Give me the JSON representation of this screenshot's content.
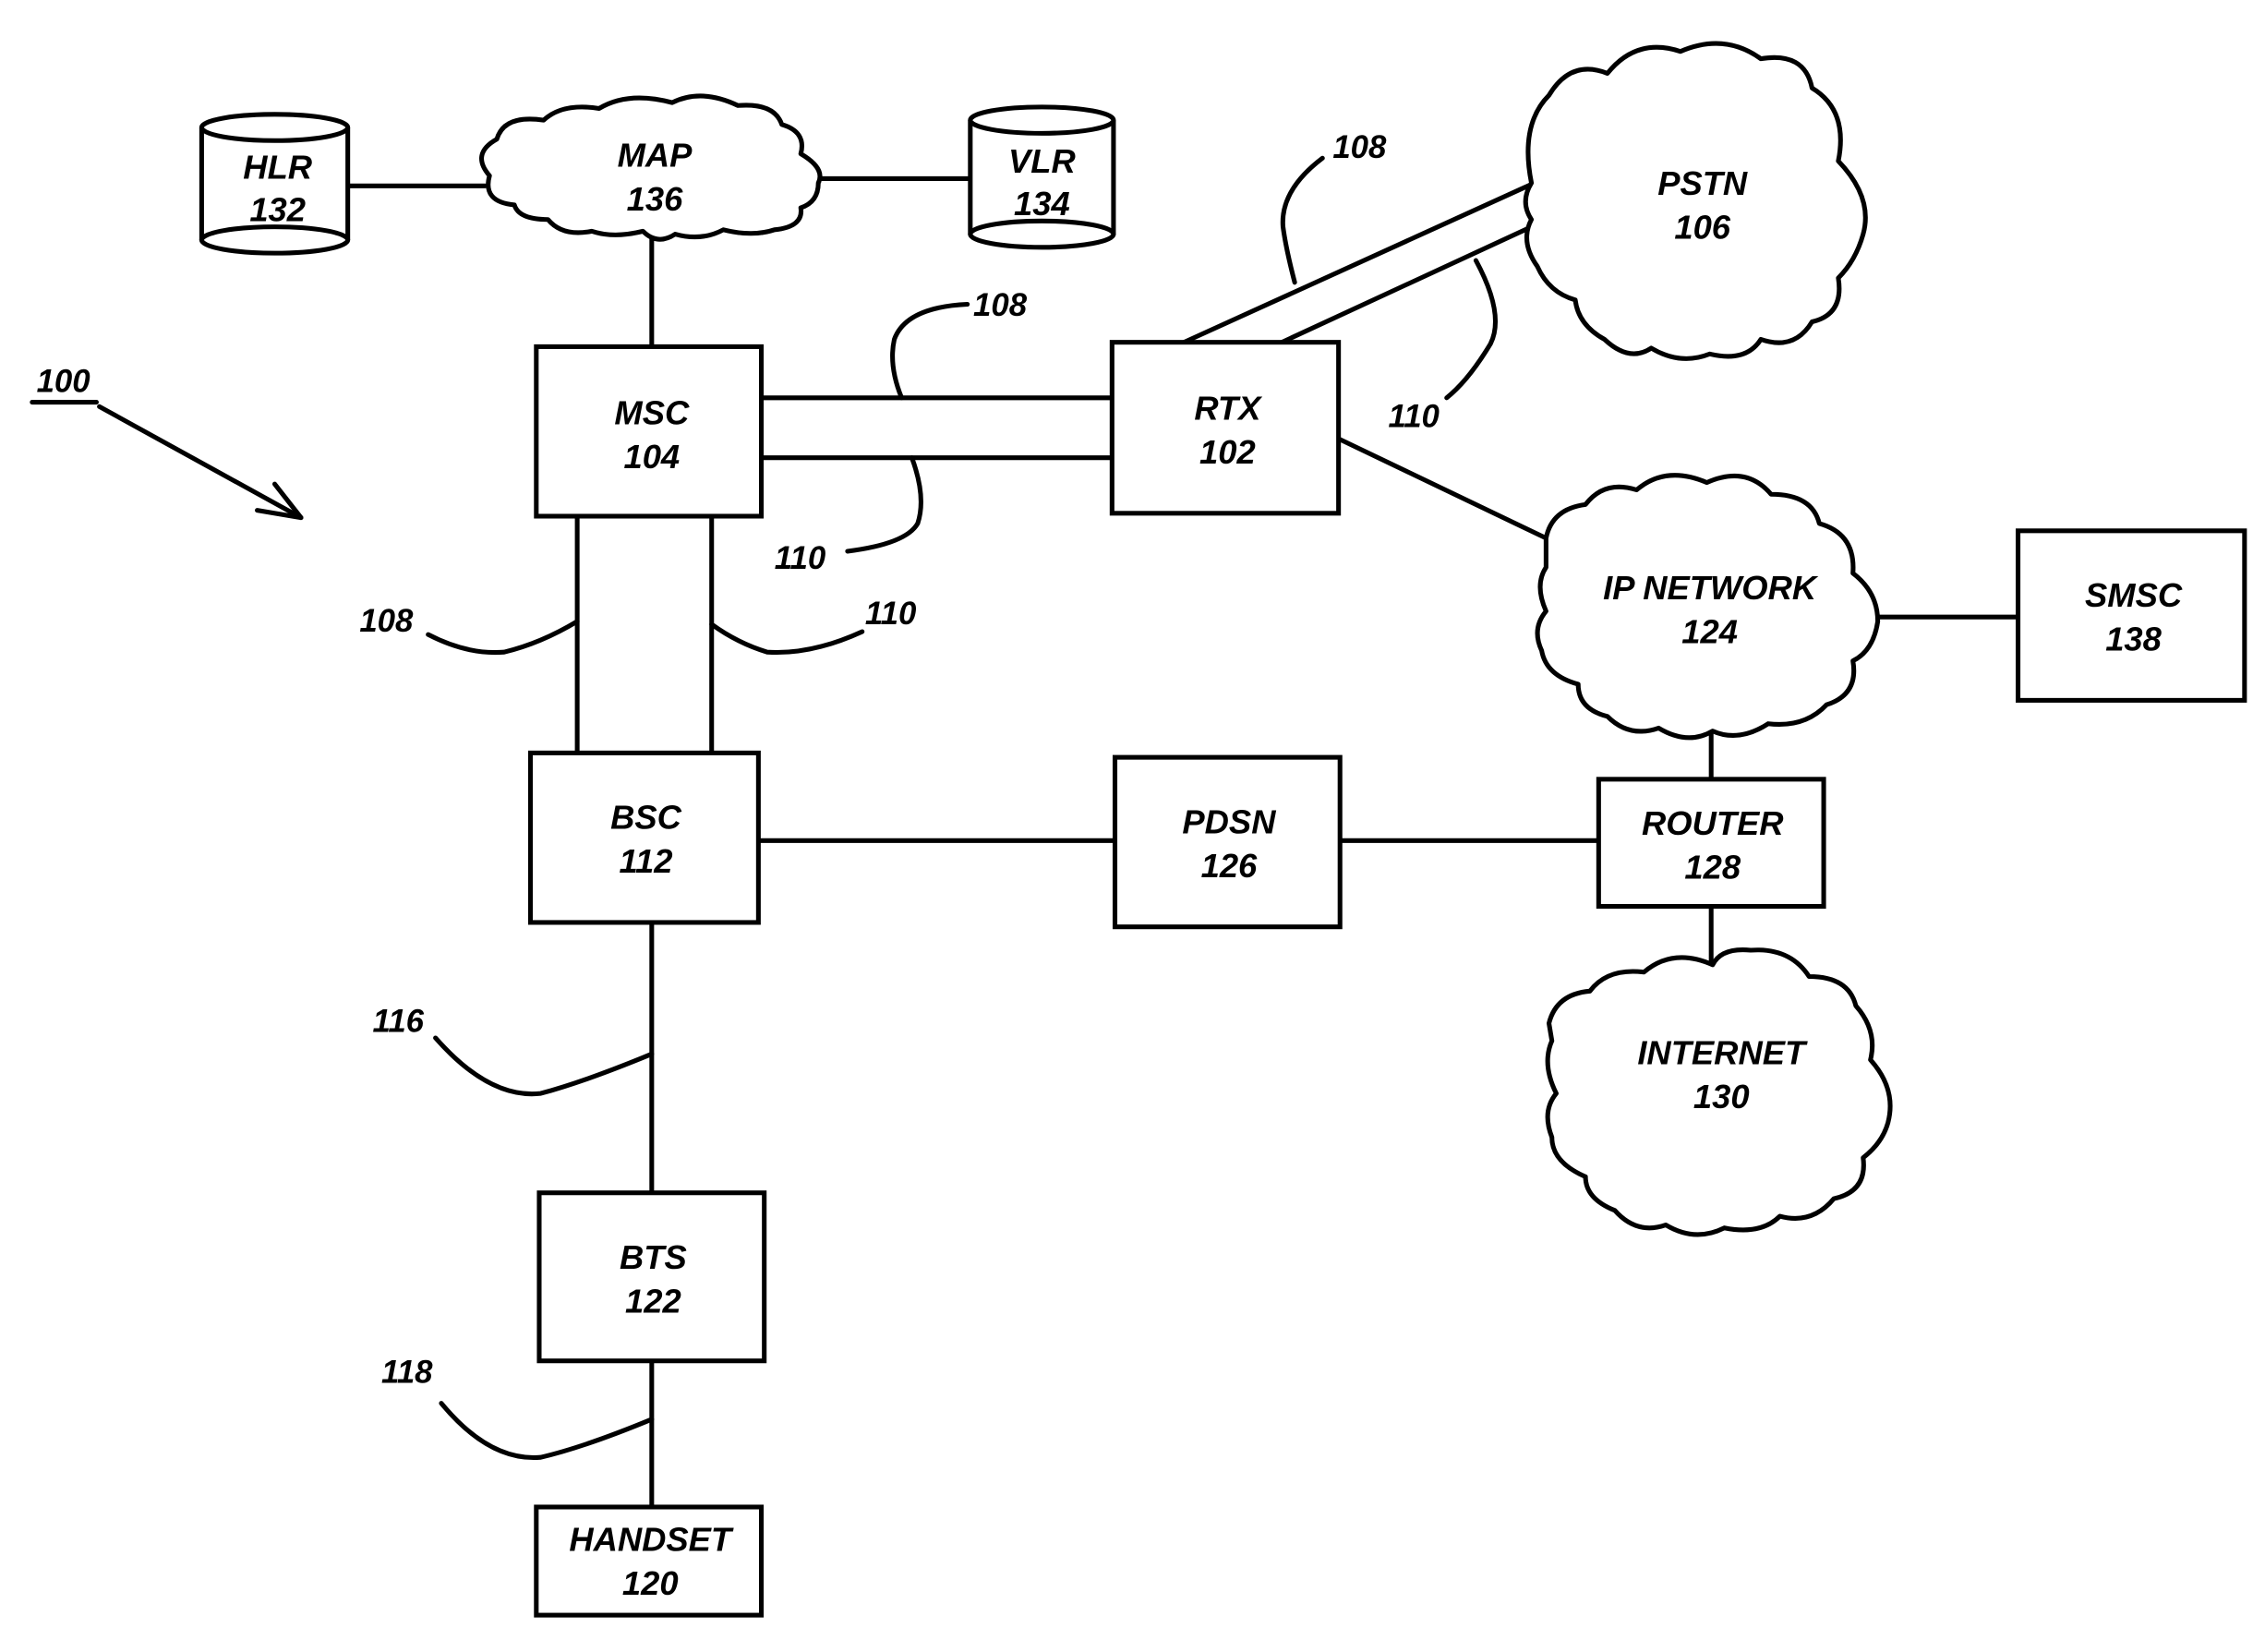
{
  "figure": {
    "reference": "100",
    "description": "Telecommunications network block diagram"
  },
  "nodes": {
    "hlr": {
      "name": "HLR",
      "number": "132",
      "shape": "database"
    },
    "map": {
      "name": "MAP",
      "number": "136",
      "shape": "cloud"
    },
    "vlr": {
      "name": "VLR",
      "number": "134",
      "shape": "database"
    },
    "msc": {
      "name": "MSC",
      "number": "104",
      "shape": "box"
    },
    "rtx": {
      "name": "RTX",
      "number": "102",
      "shape": "box"
    },
    "pstn": {
      "name": "PSTN",
      "number": "106",
      "shape": "cloud"
    },
    "ipnet": {
      "name": "IP NETWORK",
      "number": "124",
      "shape": "cloud"
    },
    "smsc": {
      "name": "SMSC",
      "number": "138",
      "shape": "box"
    },
    "bsc": {
      "name": "BSC",
      "number": "112",
      "shape": "box"
    },
    "pdsn": {
      "name": "PDSN",
      "number": "126",
      "shape": "box"
    },
    "router": {
      "name": "ROUTER",
      "number": "128",
      "shape": "box"
    },
    "internet": {
      "name": "INTERNET",
      "number": "130",
      "shape": "cloud"
    },
    "bts": {
      "name": "BTS",
      "number": "122",
      "shape": "box"
    },
    "handset": {
      "name": "HANDSET",
      "number": "120",
      "shape": "box"
    }
  },
  "link_refs": {
    "rtx_pstn_a": "108",
    "rtx_pstn_b": "110",
    "msc_rtx_a": "108",
    "msc_rtx_b": "110",
    "msc_bsc_a": "108",
    "msc_bsc_b": "110",
    "bsc_bts": "116",
    "bts_handset": "118"
  },
  "edges": [
    [
      "HLR",
      "MAP"
    ],
    [
      "MAP",
      "VLR"
    ],
    [
      "MAP",
      "MSC"
    ],
    [
      "MSC",
      "RTX"
    ],
    [
      "MSC",
      "RTX"
    ],
    [
      "RTX",
      "PSTN"
    ],
    [
      "RTX",
      "PSTN"
    ],
    [
      "RTX",
      "IP NETWORK"
    ],
    [
      "IP NETWORK",
      "SMSC"
    ],
    [
      "IP NETWORK",
      "ROUTER"
    ],
    [
      "MSC",
      "BSC"
    ],
    [
      "MSC",
      "BSC"
    ],
    [
      "BSC",
      "PDSN"
    ],
    [
      "PDSN",
      "ROUTER"
    ],
    [
      "ROUTER",
      "INTERNET"
    ],
    [
      "BSC",
      "BTS"
    ],
    [
      "BTS",
      "HANDSET"
    ]
  ]
}
